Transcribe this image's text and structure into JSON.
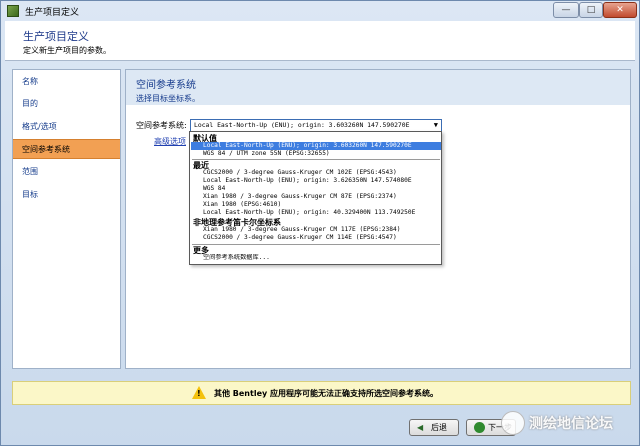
{
  "window": {
    "title": "生产项目定义",
    "minimize": "—",
    "maximize": "□",
    "close": "✕"
  },
  "header": {
    "title": "生产项目定义",
    "subtitle": "定义新生产项目的参数。"
  },
  "sidebar": {
    "items": [
      {
        "label": "名称"
      },
      {
        "label": "目的"
      },
      {
        "label": "格式/选项"
      },
      {
        "label": "空间参考系统",
        "active": true
      },
      {
        "label": "范围"
      },
      {
        "label": "目标"
      }
    ]
  },
  "main": {
    "title": "空间参考系统",
    "subtitle": "选择目标坐标系。",
    "field_label": "空间参考系统:",
    "combo_value": "Local East-North-Up (ENU); origin: 3.603260N 147.590270E",
    "advanced_link": "高级选项"
  },
  "dropdown": {
    "groups": [
      {
        "label": "默认值",
        "items": [
          {
            "text": "Local East-North-Up (ENU); origin: 3.603260N 147.590270E",
            "selected": true
          },
          {
            "text": "WGS 84 / UTM zone 55N (EPSG:32655)"
          }
        ]
      },
      {
        "label": "最近",
        "items": [
          {
            "text": "CGCS2000 / 3-degree Gauss-Kruger CM 102E (EPSG:4543)"
          },
          {
            "text": "Local East-North-Up (ENU); origin: 3.626350N 147.574080E"
          },
          {
            "text": "WGS 84"
          },
          {
            "text": "Xian 1980 / 3-degree Gauss-Kruger CM 87E (EPSG:2374)"
          },
          {
            "text": "Xian 1980 (EPSG:4610)"
          },
          {
            "text": "Local East-North-Up (ENU); origin: 40.329400N 113.749250E"
          }
        ]
      },
      {
        "label": "非地理参考笛卡尔坐标系",
        "items": [
          {
            "text": "Xian 1980 / 3-degree Gauss-Kruger CM 117E (EPSG:2384)"
          },
          {
            "text": "CGCS2000 / 3-degree Gauss-Kruger CM 114E (EPSG:4547)"
          }
        ]
      },
      {
        "label": "更多",
        "items": [
          {
            "text": "空间参考系统数据库..."
          }
        ]
      }
    ]
  },
  "warning": {
    "text": "其他 Bentley 应用程序可能无法正确支持所选空间参考系统。"
  },
  "buttons": {
    "back": "后退",
    "next": "下一步"
  },
  "watermark": {
    "text": "测绘地信论坛"
  },
  "colors": {
    "accent": "#f2a053",
    "selection": "#3d7de0",
    "link": "#153a8c"
  }
}
